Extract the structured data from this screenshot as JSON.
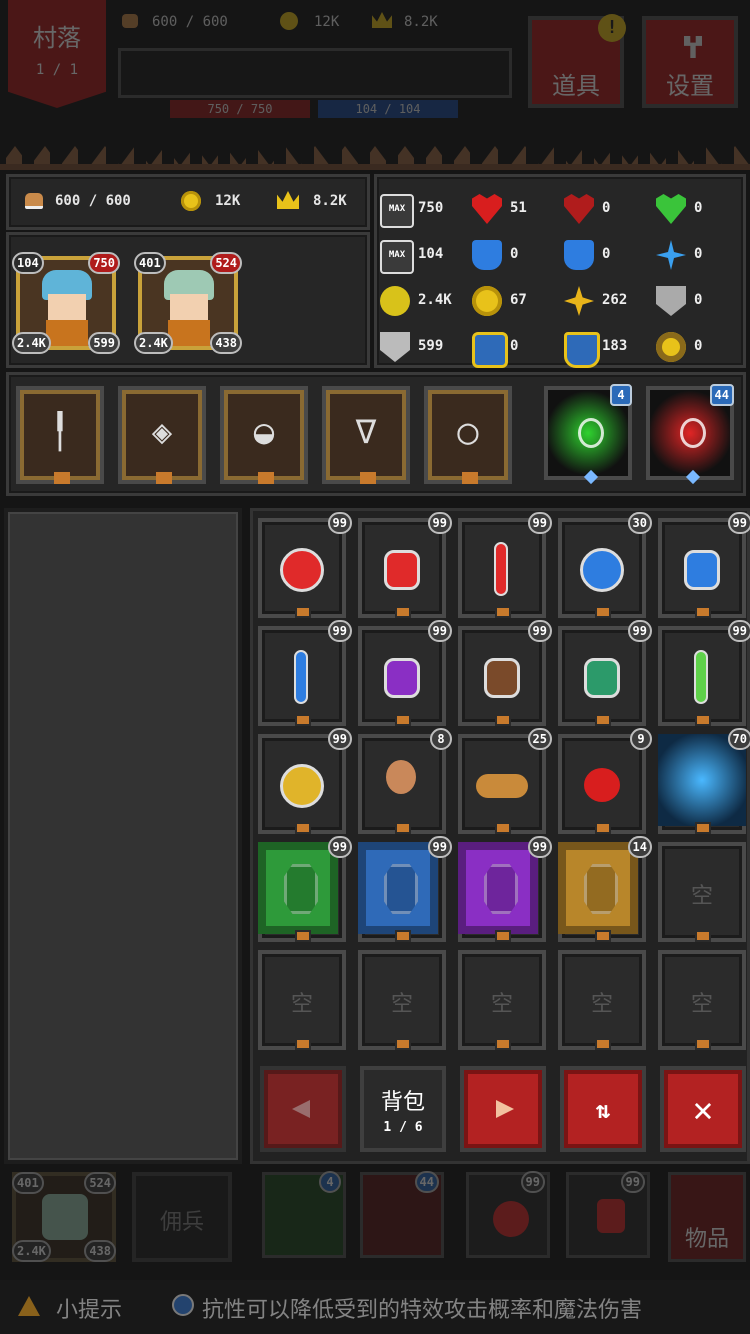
{
  "top_bar": {
    "village_label": "村落",
    "village_progress": "1 / 1",
    "food": "600 / 600",
    "gold": "12K",
    "crown": "8.2K",
    "hp_text": "750 / 750",
    "mp_text": "104 / 104",
    "items_label": "道具",
    "settings_label": "设置"
  },
  "resources": {
    "food": "600 / 600",
    "gold": "12K",
    "crown": "8.2K"
  },
  "heroes": [
    {
      "level": "104",
      "hp": "750",
      "atk": "2.4K",
      "def": "599",
      "hair": "#5fb4d8"
    },
    {
      "level": "401",
      "hp": "524",
      "atk": "2.4K",
      "def": "438",
      "hair": "#9ec9b4"
    }
  ],
  "stats": [
    [
      {
        "icon": "max-hp-icon",
        "label": "MAX",
        "value": "750"
      },
      {
        "icon": "heart-plus-icon",
        "value": "51"
      },
      {
        "icon": "heart-s-icon",
        "value": "0"
      },
      {
        "icon": "green-heart-icon",
        "value": "0"
      }
    ],
    [
      {
        "icon": "max-mp-icon",
        "label": "MAX",
        "value": "104"
      },
      {
        "icon": "mana-plus-icon",
        "value": "0"
      },
      {
        "icon": "mana-s-icon",
        "value": "0"
      },
      {
        "icon": "crosshair-icon",
        "value": "0"
      }
    ],
    [
      {
        "icon": "attack-potion-icon",
        "value": "2.4K"
      },
      {
        "icon": "gold-orb-icon",
        "value": "67"
      },
      {
        "icon": "gold-cross-icon",
        "value": "262"
      },
      {
        "icon": "broken-shield-icon",
        "value": "0"
      }
    ],
    [
      {
        "icon": "armor-icon",
        "value": "599"
      },
      {
        "icon": "blue-gem-icon",
        "value": "0"
      },
      {
        "icon": "gold-shield-icon",
        "value": "183"
      },
      {
        "icon": "gold-ring-icon",
        "value": "0"
      }
    ]
  ],
  "equipment": [
    {
      "icon": "staff-icon"
    },
    {
      "icon": "shield-icon"
    },
    {
      "icon": "helmet-icon"
    },
    {
      "icon": "necklace-icon"
    },
    {
      "icon": "ring-icon"
    }
  ],
  "skills": [
    {
      "icon": "green-lightning-skill-icon",
      "count": "4",
      "color": "#2fd22f"
    },
    {
      "icon": "red-sword-skill-icon",
      "count": "44",
      "color": "#e02525"
    }
  ],
  "inventory": [
    {
      "icon": "red-round-potion-icon",
      "count": "99",
      "color": "#e02a2a",
      "shape": "round"
    },
    {
      "icon": "red-square-potion-icon",
      "count": "99",
      "color": "#e02a2a",
      "shape": "square"
    },
    {
      "icon": "red-vial-icon",
      "count": "99",
      "color": "#e02a2a",
      "shape": "vial"
    },
    {
      "icon": "blue-round-potion-icon",
      "count": "30",
      "color": "#2e7de0",
      "shape": "round"
    },
    {
      "icon": "blue-square-potion-icon",
      "count": "99",
      "color": "#2e7de0",
      "shape": "square"
    },
    {
      "icon": "blue-vial-icon",
      "count": "99",
      "color": "#2e7de0",
      "shape": "vial"
    },
    {
      "icon": "purple-potion-icon",
      "count": "99",
      "color": "#8a2fc4",
      "shape": "square"
    },
    {
      "icon": "brown-potion-icon",
      "count": "99",
      "color": "#7a4a2a",
      "shape": "square"
    },
    {
      "icon": "green-potion-icon",
      "count": "99",
      "color": "#2c9a6a",
      "shape": "square"
    },
    {
      "icon": "green-vial-icon",
      "count": "99",
      "color": "#5fd24a",
      "shape": "vial"
    },
    {
      "icon": "yellow-round-potion-icon",
      "count": "99",
      "color": "#e0b42a",
      "shape": "round"
    },
    {
      "icon": "drumstick-icon",
      "count": "8",
      "color": "#c9885a",
      "shape": "meat"
    },
    {
      "icon": "bread-icon",
      "count": "25",
      "color": "#c98a3a",
      "shape": "bread"
    },
    {
      "icon": "apple-icon",
      "count": "9",
      "color": "#d81e1e",
      "shape": "apple"
    },
    {
      "icon": "blue-lightning-scroll-icon",
      "count": "70",
      "color": "#4ab8ff",
      "shape": "skill"
    },
    {
      "icon": "green-gem-icon",
      "count": "99",
      "color": "#2e9a3a",
      "shape": "gem"
    },
    {
      "icon": "blue-gem-card-icon",
      "count": "99",
      "color": "#2f6ab8",
      "shape": "gem"
    },
    {
      "icon": "purple-gem-card-icon",
      "count": "99",
      "color": "#8a2fc4",
      "shape": "gem"
    },
    {
      "icon": "amber-gem-card-icon",
      "count": "14",
      "color": "#b8862a",
      "shape": "gem"
    },
    {
      "empty": "空"
    },
    {
      "empty": "空"
    },
    {
      "empty": "空"
    },
    {
      "empty": "空"
    },
    {
      "empty": "空"
    },
    {
      "empty": "空"
    }
  ],
  "bag": {
    "label": "背包",
    "page": "1 / 6"
  },
  "dock": {
    "mercenary_label": "佣兵",
    "items_label": "物品",
    "hero_level": "401",
    "hero_hp": "524",
    "hero_atk": "2.4K",
    "hero_def": "438",
    "skill1_count": "4",
    "skill2_count": "44",
    "pot1_count": "99",
    "pot2_count": "99"
  },
  "tip": {
    "label": "小提示",
    "text": "抗性可以降低受到的特效攻击概率和魔法伤害"
  }
}
